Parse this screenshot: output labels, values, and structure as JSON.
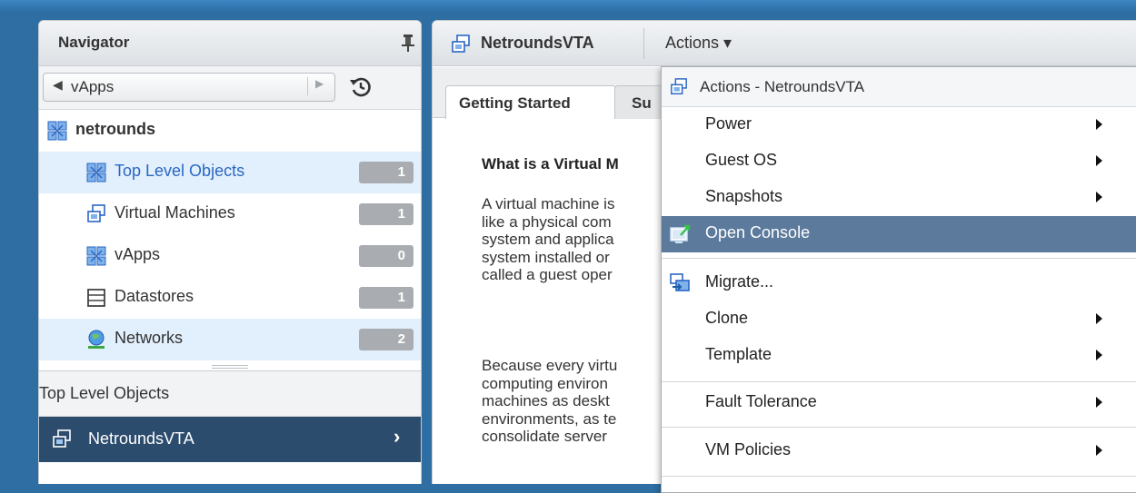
{
  "navigator": {
    "title": "Navigator",
    "back_label": "vApps",
    "tree": {
      "root": "netrounds",
      "items": [
        {
          "label": "Top Level Objects",
          "count": "1"
        },
        {
          "label": "Virtual Machines",
          "count": "1"
        },
        {
          "label": "vApps",
          "count": "0"
        },
        {
          "label": "Datastores",
          "count": "1"
        },
        {
          "label": "Networks",
          "count": "2"
        }
      ]
    },
    "related": {
      "title": "Top Level Objects",
      "item": "NetroundsVTA"
    }
  },
  "main": {
    "object_title": "NetroundsVTA",
    "actions_label": "Actions ▾",
    "tabs": [
      {
        "label": "Getting Started"
      },
      {
        "label": "Su"
      }
    ],
    "content": {
      "heading": "What is a Virtual M",
      "para1": [
        "A virtual machine is",
        "like a physical com",
        "system and applica",
        "system installed or",
        "called a guest oper"
      ],
      "para2": [
        "Because every virtu",
        "computing environ",
        "machines as deskt",
        "environments, as te",
        "consolidate server"
      ]
    }
  },
  "actions_menu": {
    "header": "Actions - NetroundsVTA",
    "items": {
      "power": "Power",
      "guest_os": "Guest OS",
      "snapshots": "Snapshots",
      "open_console": "Open Console",
      "migrate": "Migrate...",
      "clone": "Clone",
      "template": "Template",
      "fault_tolerance": "Fault Tolerance",
      "vm_policies": "VM Policies"
    }
  },
  "colors": {
    "selected_tree_bg": "#e2effc",
    "selected_tree_text": "#2b67c3",
    "related_selected_bg": "#2c4c6e",
    "menu_highlight_bg": "#5c7a9c",
    "badge_bg": "#a9adb1",
    "background_blue": "#2e6ea3"
  }
}
